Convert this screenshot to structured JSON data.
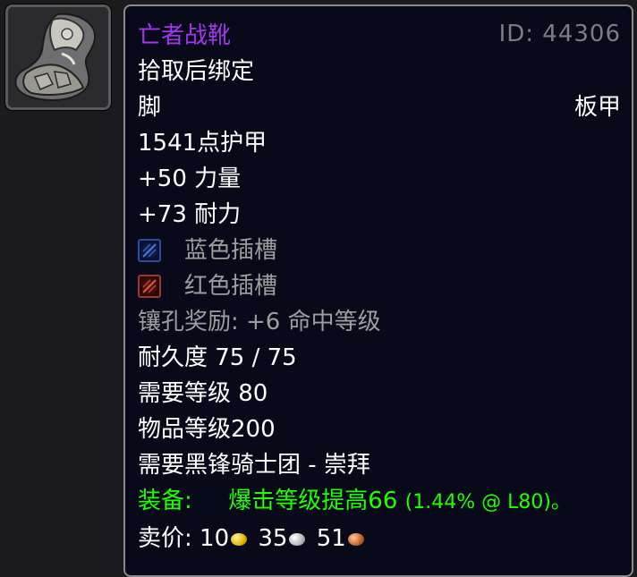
{
  "item": {
    "name": "亡者战靴",
    "id_text": "ID: 44306",
    "bind": "拾取后绑定",
    "slot": "脚",
    "armor_type": "板甲",
    "armor": "1541点护甲",
    "stats": [
      "+50 力量",
      "+73 耐力"
    ],
    "sockets": [
      {
        "color": "blue",
        "label": "蓝色插槽"
      },
      {
        "color": "red",
        "label": "红色插槽"
      }
    ],
    "socket_bonus": "镶孔奖励: +6 命中等级",
    "durability": "耐久度 75 / 75",
    "required_level": "需要等级 80",
    "item_level": "物品等级200",
    "reputation": "需要黑锋骑士团 - 崇拜",
    "equip_prefix": "装备:",
    "equip_effect": "爆击等级提高66",
    "equip_detail": "(1.44% @ L80)。",
    "sell_price": {
      "label": "卖价:",
      "gold": "10",
      "silver": "35",
      "copper": "51"
    }
  },
  "colors": {
    "epic": "#a335ee",
    "gray": "#9d9d9d",
    "green": "#1eff00",
    "background": "#080a1a"
  },
  "icons": [
    "boot-icon",
    "blue-socket-icon",
    "red-socket-icon",
    "gold-coin-icon",
    "silver-coin-icon",
    "copper-coin-icon"
  ]
}
